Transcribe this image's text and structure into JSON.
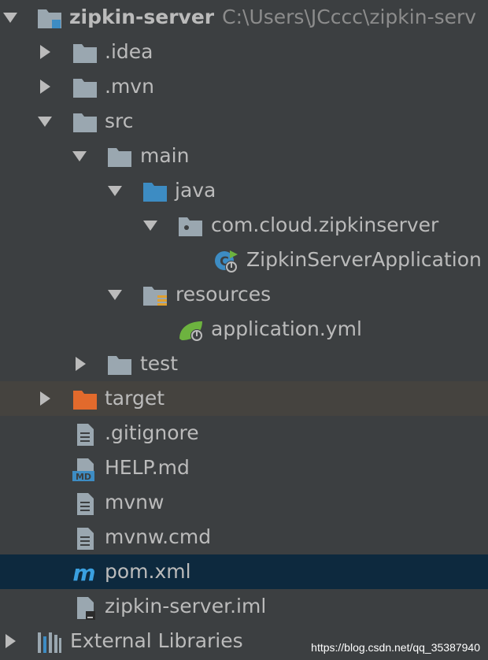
{
  "project": {
    "name": "zipkin-server",
    "path": "C:\\Users\\JCccc\\zipkin-serv"
  },
  "tree": {
    "idea": ".idea",
    "mvn": ".mvn",
    "src": "src",
    "main": "main",
    "java": "java",
    "package": "com.cloud.zipkinserver",
    "app_class": "ZipkinServerApplication",
    "resources": "resources",
    "app_yml": "application.yml",
    "test": "test",
    "target": "target",
    "gitignore": ".gitignore",
    "help_md": "HELP.md",
    "mvnw": "mvnw",
    "mvnw_cmd": "mvnw.cmd",
    "pom": "pom.xml",
    "iml": "zipkin-server.iml",
    "external_libraries": "External Libraries"
  },
  "icons": {
    "folder": "folder-icon",
    "module_folder": "module-folder-icon",
    "source_folder": "source-folder-icon",
    "package": "package-icon",
    "spring_boot_class": "spring-boot-class-icon",
    "resources_folder": "resources-folder-icon",
    "spring_config": "spring-config-icon",
    "excluded_folder": "excluded-folder-icon",
    "text_file": "text-file-icon",
    "markdown": "markdown-icon",
    "maven": "maven-icon",
    "iml": "iml-file-icon",
    "libraries": "libraries-icon"
  },
  "colors": {
    "background": "#3c3f41",
    "text": "#bbbbbb",
    "folder": "#9aa7b0",
    "source_folder": "#3d8cc3",
    "excluded_folder": "#e26a2c",
    "spring": "#6db33f",
    "target_row_bg": "#45433f",
    "selected_row_bg": "#0d293e",
    "maven": "#3aa0e0"
  },
  "watermark": "https://blog.csdn.net/qq_35387940"
}
